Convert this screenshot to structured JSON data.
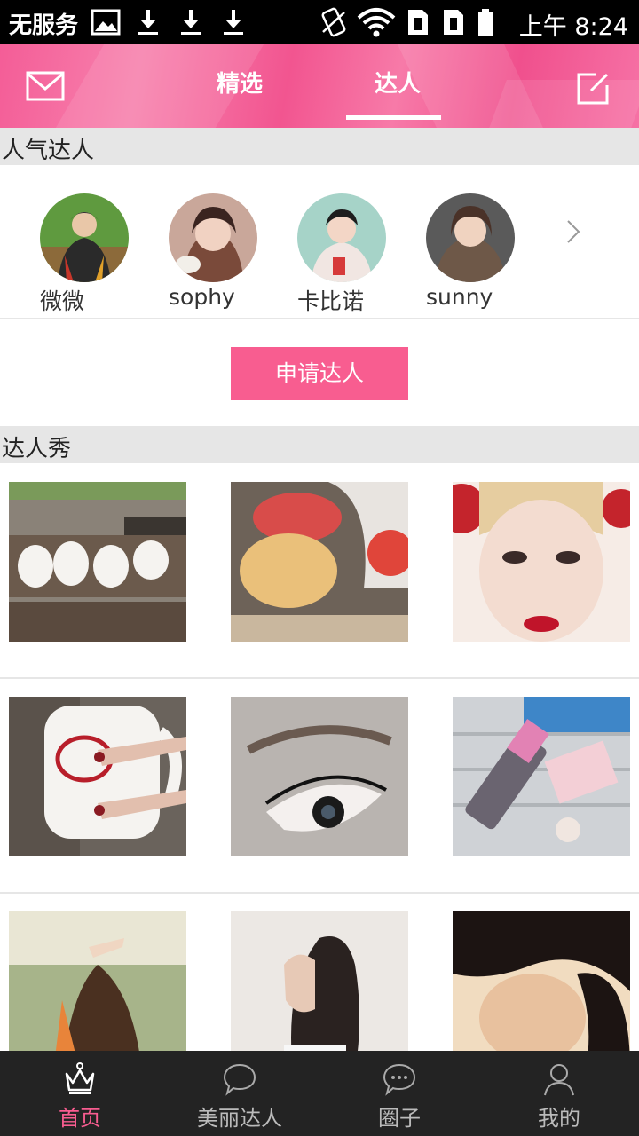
{
  "status_bar": {
    "carrier": "无服务",
    "time": "上午 8:24",
    "icons": [
      "image-icon",
      "download-icon",
      "download-icon",
      "download-icon",
      "no-sim-icon",
      "wifi-icon",
      "sim-1-icon",
      "sim-2-icon",
      "battery-icon"
    ]
  },
  "header": {
    "tabs": [
      {
        "label": "精选",
        "active": false
      },
      {
        "label": "达人",
        "active": true
      }
    ],
    "left_icon": "mail-icon",
    "right_icon": "compose-icon"
  },
  "popular_experts": {
    "title": "人气达人",
    "experts": [
      {
        "name": "微微"
      },
      {
        "name": "sophy"
      },
      {
        "name": "卡比诺"
      },
      {
        "name": "sunny"
      }
    ],
    "more_icon": "chevron-right-icon",
    "apply_button": "申请达人"
  },
  "expert_show": {
    "title": "达人秀"
  },
  "bottom_nav": [
    {
      "label": "首页",
      "icon": "crown-icon",
      "active": true
    },
    {
      "label": "美丽达人",
      "icon": "chat-bubble-icon",
      "active": false
    },
    {
      "label": "圈子",
      "icon": "chat-dots-icon",
      "active": false
    },
    {
      "label": "我的",
      "icon": "person-icon",
      "active": false
    }
  ],
  "colors": {
    "accent": "#f85d90",
    "header_pink": "#f25590",
    "section_bg": "#e6e6e6",
    "nav_bg": "#232323"
  }
}
